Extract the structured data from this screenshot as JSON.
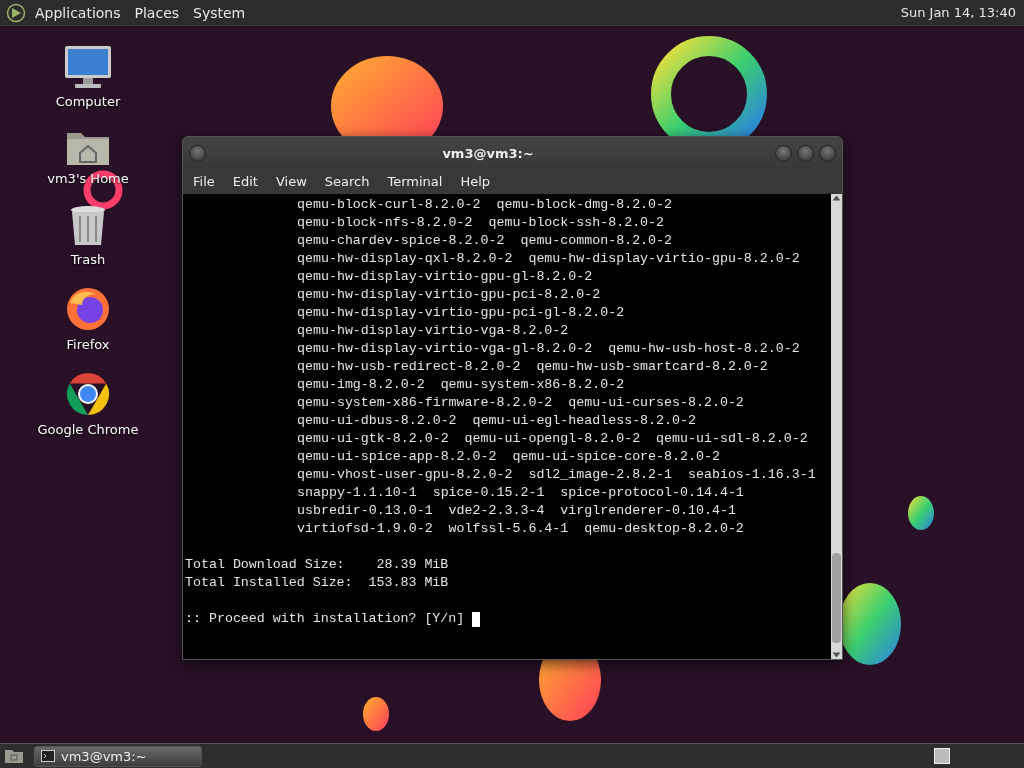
{
  "top_panel": {
    "menus": [
      "Applications",
      "Places",
      "System"
    ],
    "clock": "Sun Jan 14, 13:40"
  },
  "desktop_icons": [
    {
      "kind": "computer",
      "label": "Computer"
    },
    {
      "kind": "home",
      "label": "vm3's Home"
    },
    {
      "kind": "trash",
      "label": "Trash"
    },
    {
      "kind": "firefox",
      "label": "Firefox"
    },
    {
      "kind": "chrome",
      "label": "Google Chrome"
    }
  ],
  "terminal_window": {
    "title": "vm3@vm3:~",
    "menu": [
      "File",
      "Edit",
      "View",
      "Search",
      "Terminal",
      "Help"
    ],
    "package_lines": [
      "qemu-block-curl-8.2.0-2  qemu-block-dmg-8.2.0-2",
      "qemu-block-nfs-8.2.0-2  qemu-block-ssh-8.2.0-2",
      "qemu-chardev-spice-8.2.0-2  qemu-common-8.2.0-2",
      "qemu-hw-display-qxl-8.2.0-2  qemu-hw-display-virtio-gpu-8.2.0-2",
      "qemu-hw-display-virtio-gpu-gl-8.2.0-2",
      "qemu-hw-display-virtio-gpu-pci-8.2.0-2",
      "qemu-hw-display-virtio-gpu-pci-gl-8.2.0-2",
      "qemu-hw-display-virtio-vga-8.2.0-2",
      "qemu-hw-display-virtio-vga-gl-8.2.0-2  qemu-hw-usb-host-8.2.0-2",
      "qemu-hw-usb-redirect-8.2.0-2  qemu-hw-usb-smartcard-8.2.0-2",
      "qemu-img-8.2.0-2  qemu-system-x86-8.2.0-2",
      "qemu-system-x86-firmware-8.2.0-2  qemu-ui-curses-8.2.0-2",
      "qemu-ui-dbus-8.2.0-2  qemu-ui-egl-headless-8.2.0-2",
      "qemu-ui-gtk-8.2.0-2  qemu-ui-opengl-8.2.0-2  qemu-ui-sdl-8.2.0-2",
      "qemu-ui-spice-app-8.2.0-2  qemu-ui-spice-core-8.2.0-2",
      "qemu-vhost-user-gpu-8.2.0-2  sdl2_image-2.8.2-1  seabios-1.16.3-1",
      "snappy-1.1.10-1  spice-0.15.2-1  spice-protocol-0.14.4-1",
      "usbredir-0.13.0-1  vde2-2.3.3-4  virglrenderer-0.10.4-1",
      "virtiofsd-1.9.0-2  wolfssl-5.6.4-1  qemu-desktop-8.2.0-2"
    ],
    "summary_lines": [
      "Total Download Size:    28.39 MiB",
      "Total Installed Size:  153.83 MiB"
    ],
    "prompt": ":: Proceed with installation? [Y/n]"
  },
  "taskbar": {
    "tasks": [
      {
        "label": "vm3@vm3:~",
        "selected": true
      }
    ]
  }
}
